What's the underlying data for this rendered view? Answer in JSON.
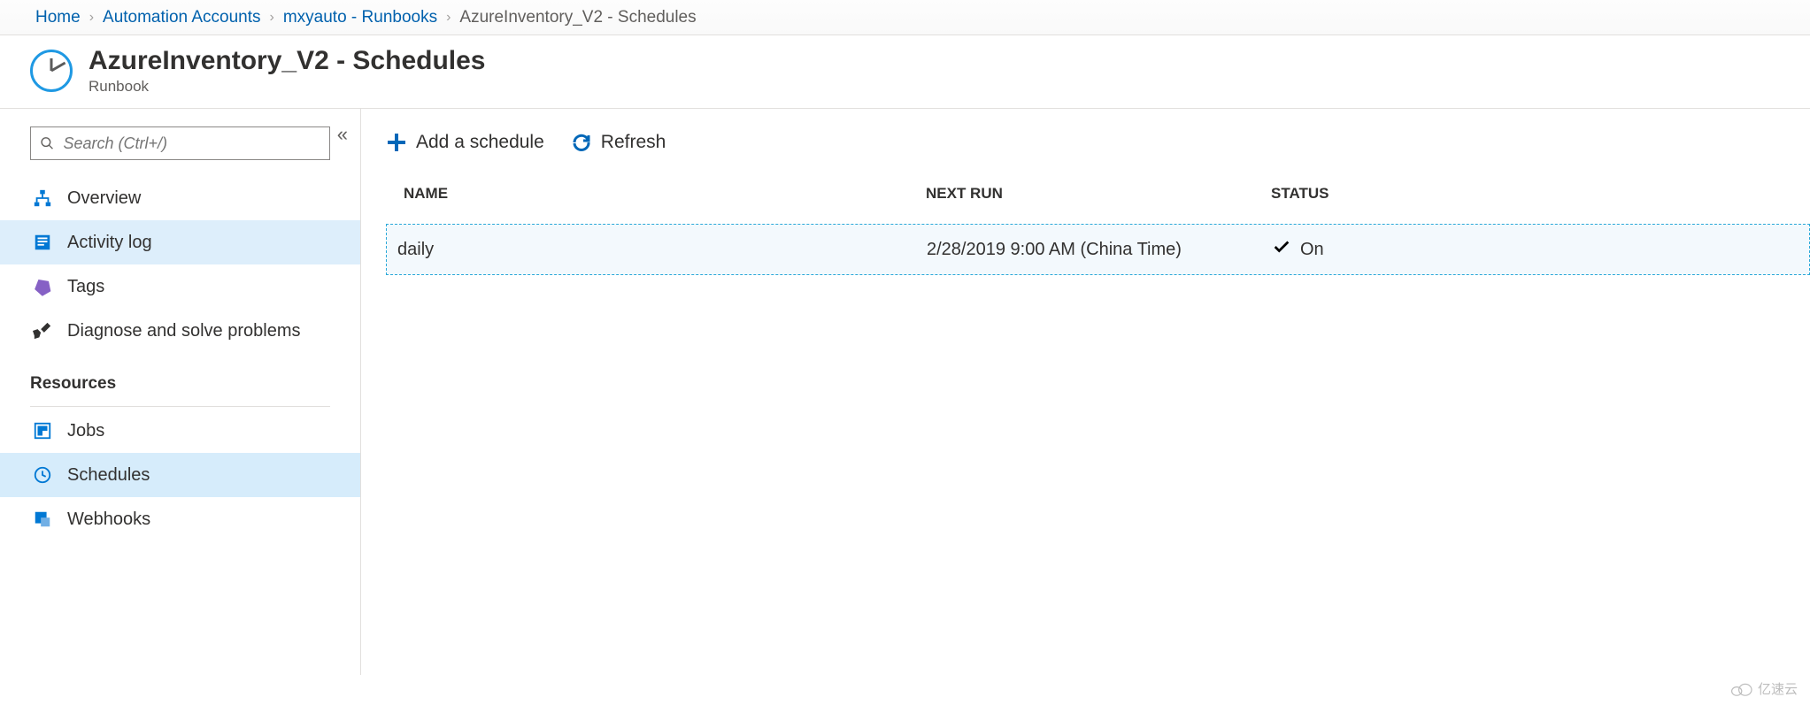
{
  "breadcrumb": {
    "home": "Home",
    "automation": "Automation Accounts",
    "account": "mxyauto - Runbooks",
    "current": "AzureInventory_V2 - Schedules"
  },
  "header": {
    "title": "AzureInventory_V2 - Schedules",
    "subtitle": "Runbook"
  },
  "search": {
    "placeholder": "Search (Ctrl+/)"
  },
  "sidebar": {
    "items": [
      {
        "label": "Overview"
      },
      {
        "label": "Activity log"
      },
      {
        "label": "Tags"
      },
      {
        "label": "Diagnose and solve problems"
      }
    ],
    "section": "Resources",
    "resources": [
      {
        "label": "Jobs"
      },
      {
        "label": "Schedules"
      },
      {
        "label": "Webhooks"
      }
    ]
  },
  "toolbar": {
    "add": "Add a schedule",
    "refresh": "Refresh"
  },
  "table": {
    "headers": {
      "name": "NAME",
      "next": "NEXT RUN",
      "status": "STATUS"
    },
    "rows": [
      {
        "name": "daily",
        "next": "2/28/2019 9:00 AM (China Time)",
        "status": "On"
      }
    ]
  },
  "watermark": "亿速云"
}
